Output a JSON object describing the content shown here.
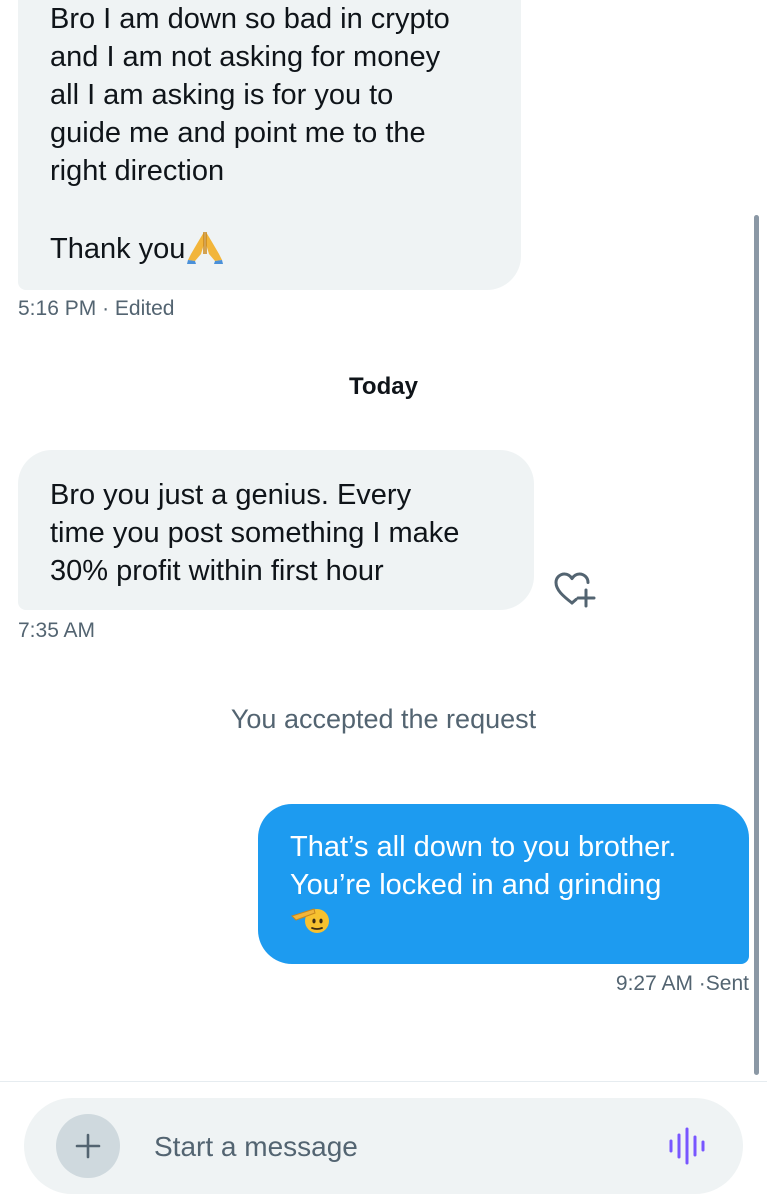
{
  "messages": [
    {
      "direction": "incoming",
      "text": "Bro I am down so bad in crypto\nand I am not asking for money\nall I am asking is for you to\nguide me and point me to the\nright direction\n\nThank you",
      "emoji": "folded-hands",
      "time": "5:16 PM",
      "status": "· Edited"
    },
    {
      "direction": "incoming",
      "text": "Bro you just a genius. Every\ntime you post something I make\n30% profit within first hour",
      "time": "7:35 AM"
    },
    {
      "direction": "outgoing",
      "text": "That’s all down to you brother.\nYou’re locked in and grinding",
      "emoji": "saluting-face",
      "time": "9:27 AM",
      "status": "·Sent"
    }
  ],
  "day_separator": "Today",
  "system_note": "You accepted the request",
  "reaction_icon": "heart-plus-icon",
  "composer": {
    "placeholder": "Start a message",
    "add_icon": "plus-icon",
    "voice_icon": "voice-waveform-icon"
  },
  "colors": {
    "incoming_bubble": "#eff3f4",
    "outgoing_bubble": "#1d9bf0",
    "meta_text": "#536471",
    "voice_icon": "#7856ff"
  }
}
